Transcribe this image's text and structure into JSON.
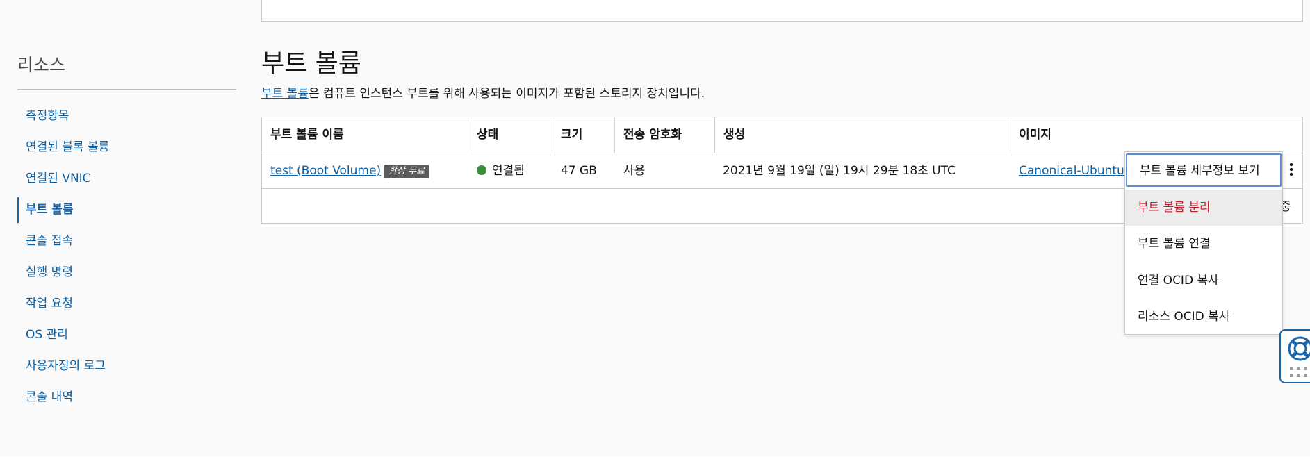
{
  "sidebar": {
    "title": "리소스",
    "items": [
      {
        "label": "측정항목",
        "active": false
      },
      {
        "label": "연결된 블록 볼륨",
        "active": false
      },
      {
        "label": "연결된 VNIC",
        "active": false
      },
      {
        "label": "부트 볼륨",
        "active": true
      },
      {
        "label": "콘솔 접속",
        "active": false
      },
      {
        "label": "실행 명령",
        "active": false
      },
      {
        "label": "작업 요청",
        "active": false
      },
      {
        "label": "OS 관리",
        "active": false
      },
      {
        "label": "사용자정의 로그",
        "active": false
      },
      {
        "label": "콘솔 내역",
        "active": false
      }
    ]
  },
  "main": {
    "title": "부트 볼륨",
    "description_link": "부트 볼륨",
    "description_rest": "은 컴퓨트 인스턴스 부트를 위해 사용되는 이미지가 포함된 스토리지 장치입니다."
  },
  "table": {
    "columns": [
      "부트 볼륨 이름",
      "상태",
      "크기",
      "전송 암호화",
      "생성",
      "이미지"
    ],
    "row": {
      "name": "test (Boot Volume)",
      "badge": "항상 무료",
      "status": "연결됨",
      "size": "47 GB",
      "encryption": "사용",
      "created": "2021년 9월 19일 (일) 19시 29분 18초 UTC",
      "image": "Canonical-Ubuntu-2"
    },
    "partial_text": "중"
  },
  "menu": {
    "items": [
      "부트 볼륨 세부정보 보기",
      "부트 볼륨 분리",
      "부트 볼륨 연결",
      "연결 OCID 복사",
      "리소스 OCID 복사"
    ]
  },
  "colors": {
    "link": "#0b5fa3",
    "status_ok": "#3b8c3b",
    "danger": "#c81f2f",
    "focus": "#5a8ed6"
  },
  "icons": {
    "help": "lifebuoy-icon",
    "actions": "kebab-menu-icon"
  }
}
